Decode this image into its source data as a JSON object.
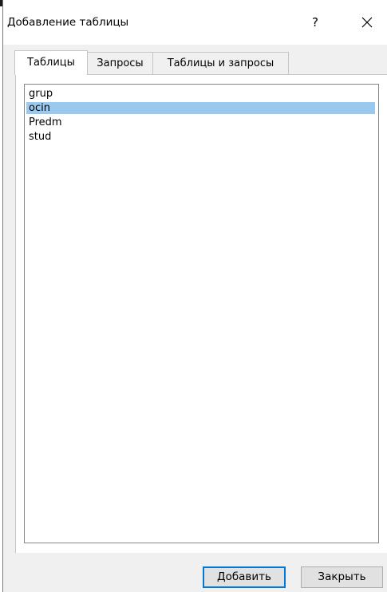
{
  "dialog": {
    "title": "Добавление таблицы",
    "help_label": "?",
    "close_icon": "close-icon"
  },
  "tabs": [
    {
      "label": "Таблицы",
      "active": true
    },
    {
      "label": "Запросы",
      "active": false
    },
    {
      "label": "Таблицы и запросы",
      "active": false
    }
  ],
  "table_list": {
    "items": [
      {
        "label": "grup",
        "selected": false
      },
      {
        "label": "ocin",
        "selected": true
      },
      {
        "label": "Predm",
        "selected": false
      },
      {
        "label": "stud",
        "selected": false
      }
    ],
    "selection_color": "#99c9ef"
  },
  "buttons": {
    "add_label": "Добавить",
    "close_label": "Закрыть"
  },
  "colors": {
    "accent_border": "#0078d7",
    "dialog_background": "#f0f0f0",
    "content_background": "#ffffff"
  }
}
